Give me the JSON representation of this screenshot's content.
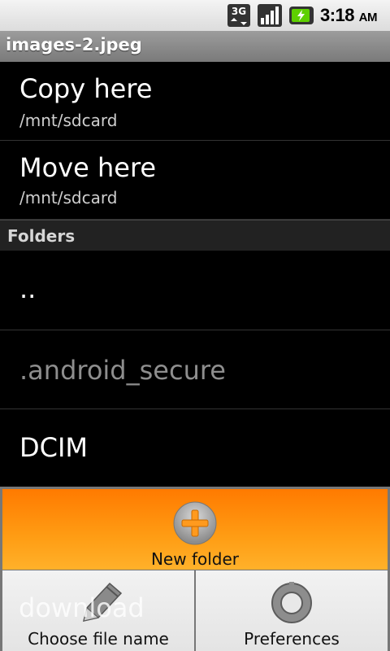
{
  "status_bar": {
    "network": "3G",
    "time": "3:18",
    "ampm": "AM"
  },
  "title": "images-2.jpeg",
  "actions": [
    {
      "label": "Copy here",
      "path": "/mnt/sdcard"
    },
    {
      "label": "Move here",
      "path": "/mnt/sdcard"
    }
  ],
  "section_header": "Folders",
  "folders": [
    {
      "name": ".."
    },
    {
      "name": ".android_secure"
    },
    {
      "name": "DCIM"
    },
    {
      "name": "download"
    }
  ],
  "menu": {
    "new_folder": "New folder",
    "choose_file_name": "Choose file name",
    "preferences": "Preferences"
  },
  "colors": {
    "menu_highlight": "#ff8c0a",
    "background": "#000000"
  }
}
